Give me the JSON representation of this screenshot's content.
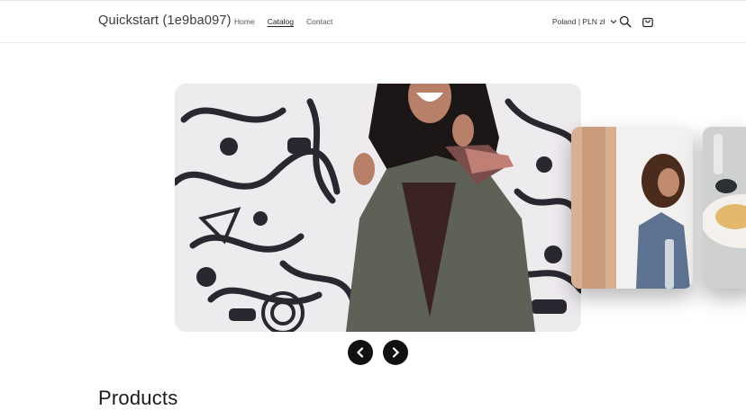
{
  "header": {
    "store_name": "Quickstart (1e9ba097)",
    "nav": [
      {
        "label": "Home",
        "active": false
      },
      {
        "label": "Catalog",
        "active": true
      },
      {
        "label": "Contact",
        "active": false
      }
    ],
    "locale": "Poland | PLN zł",
    "icons": {
      "locale": "chevron-down-icon",
      "search": "search-icon",
      "cart": "cart-icon"
    }
  },
  "carousel": {
    "slides": [
      {
        "name": "woman-graffiti-jacket",
        "state": "active"
      },
      {
        "name": "woman-denim-jacket",
        "state": "next"
      },
      {
        "name": "food-plate",
        "state": "next"
      }
    ],
    "controls": {
      "prev": "chevron-left-icon",
      "next": "chevron-right-icon"
    }
  },
  "section": {
    "title": "Products"
  },
  "colors": {
    "accent": "#121212",
    "background": "#ffffff",
    "nav_text": "#555555"
  }
}
